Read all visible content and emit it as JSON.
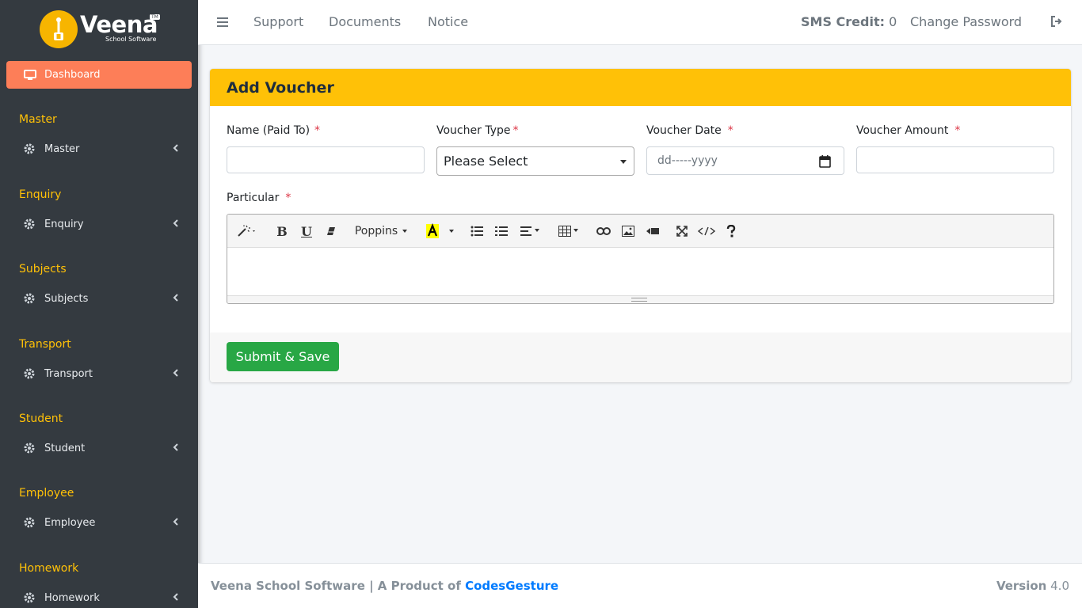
{
  "brand": {
    "name": "Veena",
    "subtitle": "School Software",
    "badge": "TM"
  },
  "sidebar": {
    "dashboard_label": "Dashboard",
    "sections": [
      {
        "header": "Master",
        "item": "Master"
      },
      {
        "header": "Enquiry",
        "item": "Enquiry"
      },
      {
        "header": "Subjects",
        "item": "Subjects"
      },
      {
        "header": "Transport",
        "item": "Transport"
      },
      {
        "header": "Student",
        "item": "Student"
      },
      {
        "header": "Employee",
        "item": "Employee"
      },
      {
        "header": "Homework",
        "item": "Homework"
      }
    ]
  },
  "topbar": {
    "links": [
      "Support",
      "Documents",
      "Notice"
    ],
    "sms_label": "SMS Credit:",
    "sms_value": "0",
    "change_password": "Change Password"
  },
  "form": {
    "title": "Add Voucher",
    "name_label": "Name (Paid To)",
    "type_label": "Voucher Type",
    "date_label": "Voucher Date",
    "amount_label": "Voucher Amount",
    "particular_label": "Particular",
    "required_mark": "*",
    "type_selected": "Please Select",
    "date_placeholder": "dd-----yyyy",
    "name_value": "",
    "amount_value": "",
    "editor_font": "Poppins",
    "submit_label": "Submit & Save"
  },
  "footer": {
    "text": "Veena School Software | A Product of",
    "company": "CodesGesture",
    "version_label": "Version",
    "version_value": "4.0"
  },
  "colors": {
    "sidebar_bg": "#343a40",
    "accent_yellow": "#ffc107",
    "dashboard_active": "#fd7e58",
    "submit_green": "#28a745",
    "link_blue": "#007bff"
  }
}
